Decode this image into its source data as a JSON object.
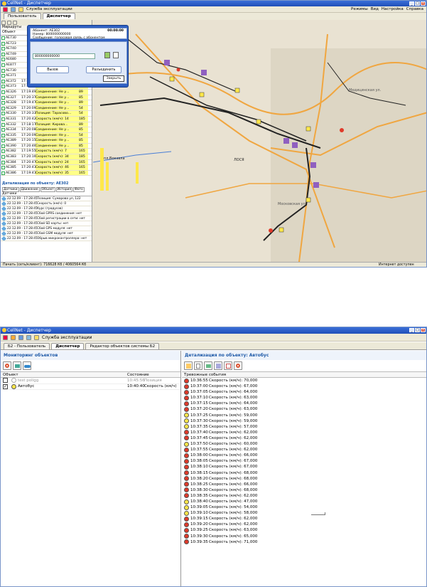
{
  "top": {
    "title": "CellNet - Диспетчер",
    "toolbar_label": "Служба эксплуатации",
    "tabs": [
      "Пользователь",
      "Диспетчер"
    ],
    "menu_right": [
      "Режимы",
      "Вид",
      "Настройка",
      "Справка"
    ],
    "left_header": [
      "Маршруты",
      "Объект"
    ],
    "object_rows_top": [
      "АЕ730",
      "АЕ723",
      "АЕ740",
      "АЕ749",
      "АЕ680",
      "АЕ877",
      "АЕ730",
      "АЕ371"
    ],
    "object_rows": [
      {
        "id": "АЕ372",
        "time": "17:19:27",
        "text": "Позиция",
        "num": ""
      },
      {
        "id": "АЕ373",
        "time": "17:19:08",
        "text": "Соединение: Не у...",
        "num": "89"
      },
      {
        "id": "АЕ326",
        "time": "17:19:49",
        "text": "Соединение: Не у...",
        "num": "89"
      },
      {
        "id": "АЕ327",
        "time": "17:20:37",
        "text": "Соединение: Не у...",
        "num": "85"
      },
      {
        "id": "АЕ328",
        "time": "17:19:47",
        "text": "Соединение: Не у...",
        "num": "89"
      },
      {
        "id": "АЕ329",
        "time": "17:20:09",
        "text": "Соединение: Не у...",
        "num": "54"
      },
      {
        "id": "АЕ330",
        "time": "17:20:33",
        "text": "Позиция: Тарасово...",
        "num": "54"
      },
      {
        "id": "АЕ331",
        "time": "17:20:42",
        "text": "Скорость (км/ч): 14",
        "num": "185"
      },
      {
        "id": "АЕ332",
        "time": "17:18:17",
        "text": "Позиция: Кирова...",
        "num": "89"
      },
      {
        "id": "АЕ334",
        "time": "17:20:08",
        "text": "Соединение: Не у...",
        "num": "85"
      },
      {
        "id": "АЕ335",
        "time": "17:20:09",
        "text": "Соединение: Не у...",
        "num": "54"
      },
      {
        "id": "АЕ389",
        "time": "17:20:15",
        "text": "Соединение: Не у...",
        "num": "85"
      },
      {
        "id": "АЕ390",
        "time": "17:20:46",
        "text": "Соединение: Не у...",
        "num": "85"
      },
      {
        "id": "АЕ382",
        "time": "17:19:55",
        "text": "Скорость (км/ч): 7",
        "num": "165"
      },
      {
        "id": "АЕ383",
        "time": "17:20:16",
        "text": "Скорость (км/ч): 34",
        "num": "185"
      },
      {
        "id": "АЕ384",
        "time": "17:20:47",
        "text": "Скорость (км/ч): 24",
        "num": "165"
      },
      {
        "id": "АЕ385",
        "time": "17:20:41",
        "text": "Скорость (км/ч): 46",
        "num": "165"
      },
      {
        "id": "АЕ386",
        "time": "17:19:41",
        "text": "Скорость (км/ч): 35",
        "num": "165"
      }
    ],
    "detail_title": "Детализация по объекту: АЕ302",
    "detail_tabs": [
      "Датчики",
      "Движение",
      "Объект",
      "История",
      "Фото"
    ],
    "detail_header": "Датчики",
    "detail_rows": [
      {
        "time": "22.12.09 - 17:28:45",
        "text": "Позиция: Сумарова ул, 122"
      },
      {
        "time": "22.12.09 - 17:28:45",
        "text": "Скорость (км/ч): 0"
      },
      {
        "time": "22.12.09 - 17:28:45",
        "text": "Курс (градусов)"
      },
      {
        "time": "22.12.09 - 17:28:45",
        "text": "Сбой GPRS соединения: нет"
      },
      {
        "time": "22.12.09 - 17:28:45",
        "text": "Сбой регистрации в сети: нет"
      },
      {
        "time": "22.12.09 - 17:28:45",
        "text": "Сбой SD карты: нет"
      },
      {
        "time": "22.12.09 - 17:28:45",
        "text": "Сбой GPS модуля: нет"
      },
      {
        "time": "22.12.09 - 17:28:45",
        "text": "Сбой GSM модуля: нет"
      },
      {
        "time": "22.12.09 - 17:28:45",
        "text": "Обрыв микроконтроллера: нет"
      }
    ],
    "popup": {
      "subscriber_label": "Абонент:",
      "subscriber": "АЕ302",
      "time": "00:00:00",
      "number_label": "Номер:",
      "number": "800000000000",
      "message_label": "Сообщение:",
      "message": "голосовая связь с абонентом",
      "phone_value": "800000000000",
      "call_button": "Вызов",
      "hangup_button": "Разъединить",
      "close_button": "Закрыть"
    },
    "map_labels": [
      "ЛОСЯ",
      "пл.Вокзала",
      "Медицинская ул.",
      "Московская ул."
    ],
    "status_left": "Пачать (сеть/клиент): 716628 Кб / 4060564 Кб",
    "status_right": "Интернет доступен"
  },
  "bottom": {
    "title": "CellNet - Диспетчер",
    "toolbar_label": "Служба эксплуатации",
    "tabs": [
      "Б2 - Пользователь",
      "Диспетчер",
      "Редактор объектов системы Б2"
    ],
    "left_title": "Мониторинг объектов",
    "columns": [
      "Объект",
      "Состояние"
    ],
    "objects": [
      {
        "name": "test poligg",
        "time": "10:45:56",
        "state": "Позиция",
        "disabled": true
      },
      {
        "name": "Автобус",
        "time": "10:40:40",
        "state": "Скорость (км/ч)",
        "disabled": false
      }
    ],
    "right_title": "Детализация по объекту:",
    "right_object": "Автобус",
    "events_header": "Тревожные события",
    "events": [
      {
        "time": "10:36:55",
        "text": "Скорость (км/ч): 70,000",
        "color": "red"
      },
      {
        "time": "10:37:00",
        "text": "Скорость (км/ч): 67,000",
        "color": "red"
      },
      {
        "time": "10:37:05",
        "text": "Скорость (км/ч): 64,000",
        "color": "red"
      },
      {
        "time": "10:37:10",
        "text": "Скорость (км/ч): 63,000",
        "color": "red"
      },
      {
        "time": "10:37:15",
        "text": "Скорость (км/ч): 64,000",
        "color": "red"
      },
      {
        "time": "10:37:20",
        "text": "Скорость (км/ч): 63,000",
        "color": "red"
      },
      {
        "time": "10:37:25",
        "text": "Скорость (км/ч): 59,000",
        "color": "yellow"
      },
      {
        "time": "10:37:30",
        "text": "Скорость (км/ч): 59,000",
        "color": "yellow"
      },
      {
        "time": "10:37:35",
        "text": "Скорость (км/ч): 57,000",
        "color": "yellow"
      },
      {
        "time": "10:37:40",
        "text": "Скорость (км/ч): 62,000",
        "color": "red"
      },
      {
        "time": "10:37:45",
        "text": "Скорость (км/ч): 62,000",
        "color": "red"
      },
      {
        "time": "10:37:50",
        "text": "Скорость (км/ч): 60,000",
        "color": "yellow"
      },
      {
        "time": "10:37:55",
        "text": "Скорость (км/ч): 62,000",
        "color": "red"
      },
      {
        "time": "10:38:00",
        "text": "Скорость (км/ч): 66,000",
        "color": "red"
      },
      {
        "time": "10:38:05",
        "text": "Скорость (км/ч): 67,000",
        "color": "red"
      },
      {
        "time": "10:38:10",
        "text": "Скорость (км/ч): 67,000",
        "color": "red"
      },
      {
        "time": "10:38:15",
        "text": "Скорость (км/ч): 68,000",
        "color": "red"
      },
      {
        "time": "10:38:20",
        "text": "Скорость (км/ч): 68,000",
        "color": "red"
      },
      {
        "time": "10:38:25",
        "text": "Скорость (км/ч): 66,000",
        "color": "red"
      },
      {
        "time": "10:38:30",
        "text": "Скорость (км/ч): 68,000",
        "color": "red"
      },
      {
        "time": "10:38:35",
        "text": "Скорость (км/ч): 62,000",
        "color": "red"
      },
      {
        "time": "10:38:40",
        "text": "Скорость (км/ч): 47,000",
        "color": "yellow"
      },
      {
        "time": "10:39:05",
        "text": "Скорость (км/ч): 54,000",
        "color": "yellow"
      },
      {
        "time": "10:39:10",
        "text": "Скорость (км/ч): 58,000",
        "color": "yellow"
      },
      {
        "time": "10:39:15",
        "text": "Скорость (км/ч): 62,000",
        "color": "red"
      },
      {
        "time": "10:39:20",
        "text": "Скорость (км/ч): 62,000",
        "color": "red"
      },
      {
        "time": "10:39:25",
        "text": "Скорость (км/ч): 63,000",
        "color": "red"
      },
      {
        "time": "10:39:30",
        "text": "Скорость (км/ч): 65,000",
        "color": "red"
      },
      {
        "time": "10:39:35",
        "text": "Скорость (км/ч): 71,000",
        "color": "red"
      }
    ]
  },
  "colors": {
    "red": "#e03a2a",
    "yellow": "#ffe84a",
    "title_blue": "#1f5aa8",
    "map_bg": "#e9e2d2",
    "road_orange": "#f0a640"
  }
}
